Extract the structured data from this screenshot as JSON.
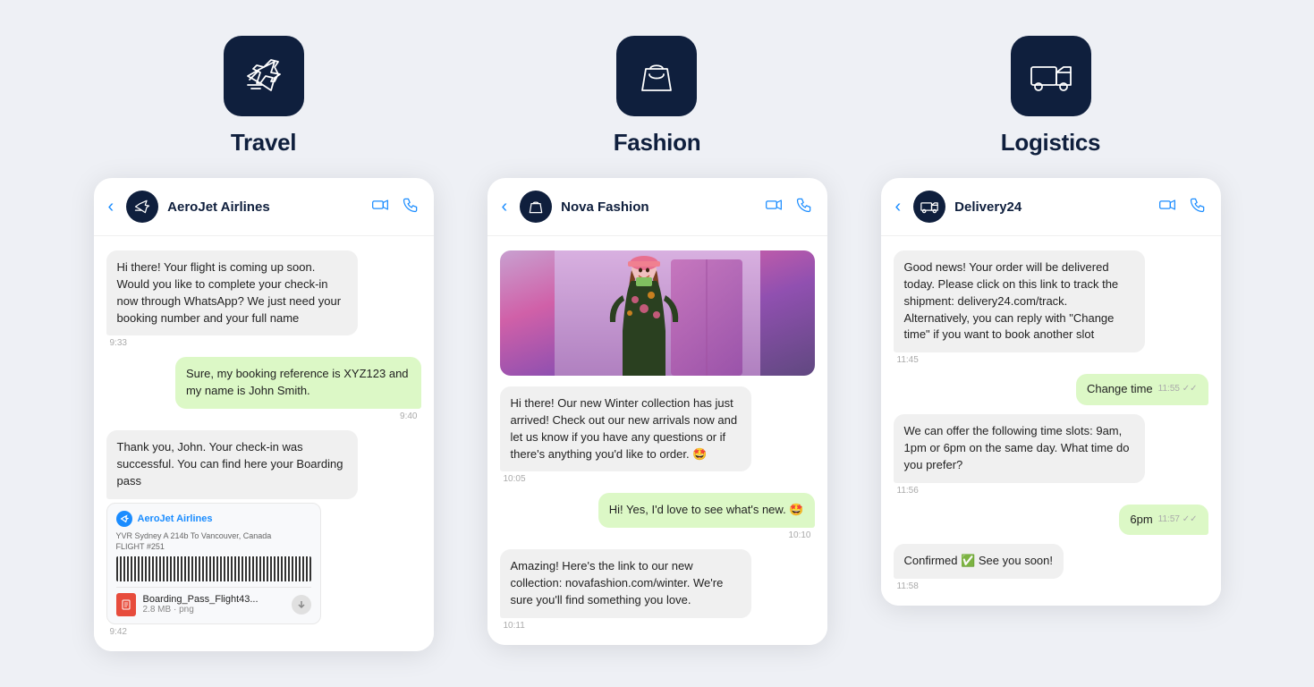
{
  "categories": [
    {
      "id": "travel",
      "title": "Travel",
      "icon": "airplane",
      "chat": {
        "name": "AeroJet Airlines",
        "avatar_icon": "airplane",
        "messages": [
          {
            "type": "received",
            "text": "Hi there! Your flight is coming up soon. Would you like to complete your check-in now through WhatsApp? We just need your booking number and your full name",
            "time": "9:33"
          },
          {
            "type": "sent",
            "text": "Sure, my booking reference is XYZ123 and my name is John Smith.",
            "time": "9:40"
          },
          {
            "type": "received",
            "text": "Thank you, John. Your check-in was successful. You can find here your Boarding pass",
            "time": null
          },
          {
            "type": "boarding_pass",
            "airline": "AeroJet Airlines",
            "route": "YVR  Sydney A 214b  To  Vancouver, Canada",
            "flight": "FLIGHT #251",
            "filename": "Boarding_Pass_Flight43...",
            "filesize": "2.8 MB · png",
            "time": "9:42"
          }
        ]
      }
    },
    {
      "id": "fashion",
      "title": "Fashion",
      "icon": "shopping_bag",
      "chat": {
        "name": "Nova Fashion",
        "avatar_icon": "shopping_bag",
        "messages": [
          {
            "type": "fashion_image",
            "time": null
          },
          {
            "type": "received",
            "text": "Hi there! Our new Winter collection has just arrived! Check out our new arrivals now and let us know if you have any questions or if there's anything you'd like to order. 🤩",
            "time": "10:05"
          },
          {
            "type": "sent",
            "text": "Hi! Yes, I'd love to see what's new. 🤩",
            "time": "10:10"
          },
          {
            "type": "received",
            "text": "Amazing! Here's the link to our new collection: novafashion.com/winter. We're sure you'll find something you love.",
            "time": "10:11"
          }
        ]
      }
    },
    {
      "id": "logistics",
      "title": "Logistics",
      "icon": "truck",
      "chat": {
        "name": "Delivery24",
        "avatar_icon": "truck",
        "messages": [
          {
            "type": "received",
            "text": "Good news! Your order will be delivered today. Please click on this link to track the shipment: delivery24.com/track. Alternatively, you can reply with \"Change time\" if you want to book another slot",
            "time": "11:45"
          },
          {
            "type": "sent",
            "text": "Change time",
            "time": "11:55",
            "checks": true
          },
          {
            "type": "received",
            "text": "We can offer the following time slots: 9am, 1pm or 6pm on the same day. What time do you prefer?",
            "time": "11:56"
          },
          {
            "type": "sent",
            "text": "6pm",
            "time": "11:57",
            "checks": true
          },
          {
            "type": "received",
            "text": "Confirmed ✅ See you soon!",
            "time": "11:58"
          }
        ]
      }
    }
  ]
}
